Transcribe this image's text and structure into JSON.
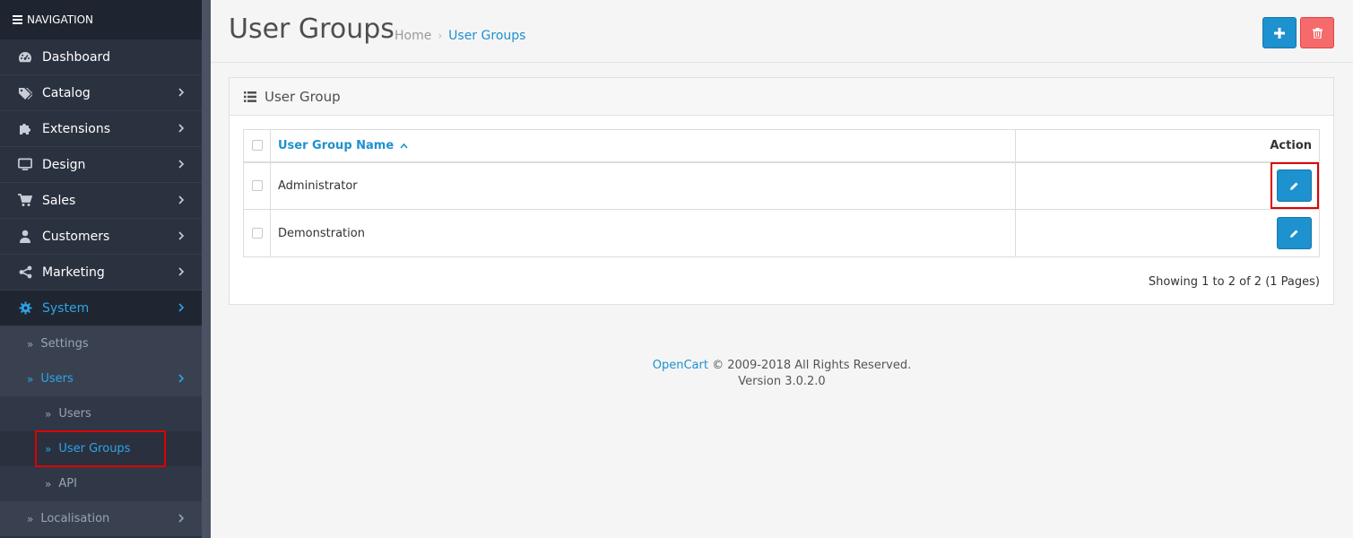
{
  "nav": {
    "heading": "NAVIGATION",
    "items": [
      {
        "label": "Dashboard",
        "icon": "dashboard-icon"
      },
      {
        "label": "Catalog",
        "icon": "tags-icon"
      },
      {
        "label": "Extensions",
        "icon": "puzzle-icon"
      },
      {
        "label": "Design",
        "icon": "desktop-icon"
      },
      {
        "label": "Sales",
        "icon": "cart-icon"
      },
      {
        "label": "Customers",
        "icon": "user-icon"
      },
      {
        "label": "Marketing",
        "icon": "share-icon"
      },
      {
        "label": "System",
        "icon": "cog-icon"
      }
    ],
    "system_sub": {
      "settings": "Settings",
      "users": "Users",
      "users_sub": {
        "users": "Users",
        "user_groups": "User Groups",
        "api": "API"
      },
      "localisation": "Localisation"
    }
  },
  "header": {
    "title": "User Groups",
    "breadcrumb": {
      "home": "Home",
      "separator": "›",
      "current": "User Groups"
    }
  },
  "panel": {
    "title": "User Group",
    "table": {
      "columns": {
        "name": "User Group Name",
        "action": "Action"
      },
      "rows": [
        {
          "name": "Administrator"
        },
        {
          "name": "Demonstration"
        }
      ]
    },
    "showing": "Showing 1 to 2 of 2 (1 Pages)"
  },
  "footer": {
    "brand": "OpenCart",
    "copyright": "© 2009-2018 All Rights Reserved.",
    "version": "Version 3.0.2.0"
  },
  "colors": {
    "accent": "#1e91cf",
    "danger": "#f56b6b",
    "sidebar_bg": "#2b323f",
    "highlight": "#e00000"
  }
}
